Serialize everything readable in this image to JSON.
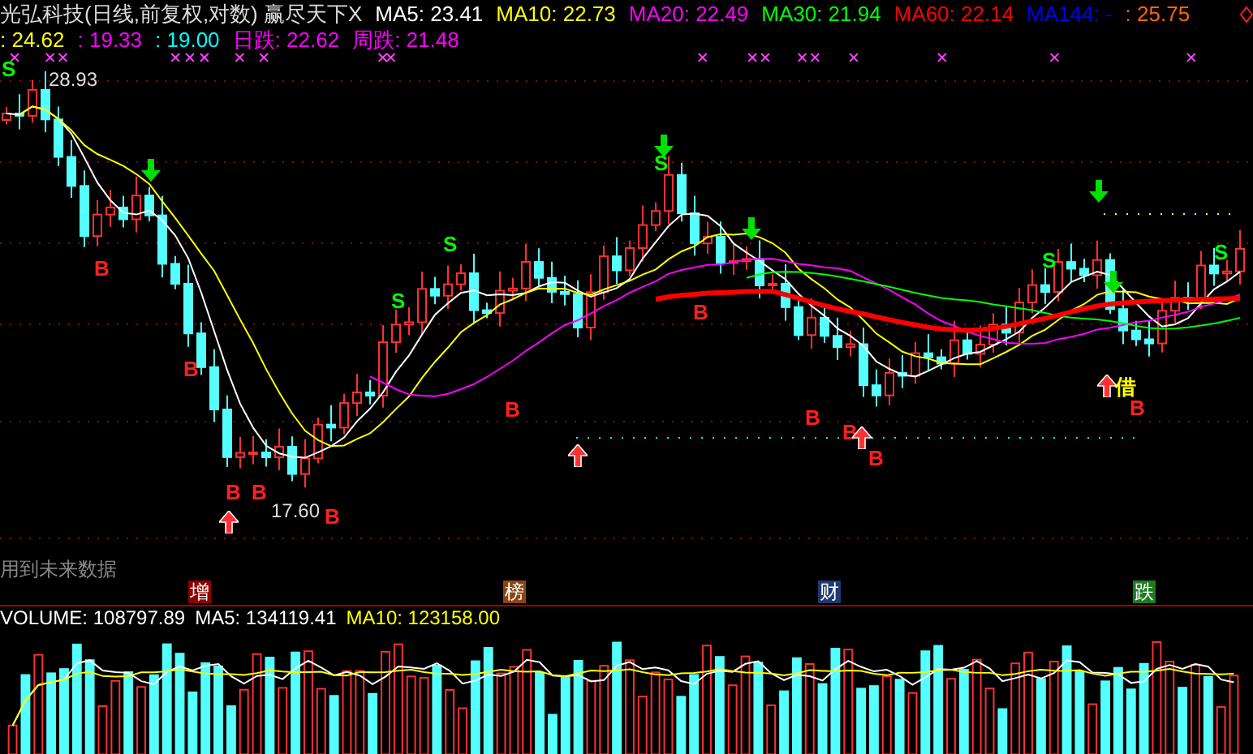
{
  "header": {
    "title": "光弘科技(日线,前复权,对数) 赢尽天下X",
    "indicators": [
      {
        "text": "MA5: 23.41",
        "color": "#ffffff"
      },
      {
        "text": "MA10: 22.73",
        "color": "#ffff00"
      },
      {
        "text": "MA20: 22.49",
        "color": "#ff00ff"
      },
      {
        "text": "MA30: 21.94",
        "color": "#00ff00"
      },
      {
        "text": "MA60: 22.14",
        "color": "#ff0000"
      },
      {
        "text": "MA144: -",
        "color": "#0000ff"
      },
      {
        "text": ": 25.75",
        "color": "#ff6600"
      }
    ],
    "indicators_line_2": [
      {
        "text": ": 24.62",
        "color": "#ffff00"
      },
      {
        "text": ": 19.33",
        "color": "#ff00ff"
      },
      {
        "text": ": 19.00",
        "color": "#00ffff"
      },
      {
        "text": "日跌: 22.62",
        "color": "#ff00ff"
      },
      {
        "text": "周跌: 21.48",
        "color": "#ff00ff"
      }
    ]
  },
  "chart": {
    "price_labels": [
      "28.93",
      "17.60"
    ],
    "markers": [
      {
        "kind": "sell",
        "text": "S"
      },
      {
        "kind": "buy",
        "text": "B"
      },
      {
        "kind": "buy",
        "text": "B"
      },
      {
        "kind": "buy",
        "text": "B"
      },
      {
        "kind": "buy",
        "text": "B"
      },
      {
        "kind": "buy",
        "text": "B"
      },
      {
        "kind": "sell",
        "text": "S"
      },
      {
        "kind": "sell",
        "text": "S"
      },
      {
        "kind": "buy",
        "text": "B"
      },
      {
        "kind": "sell",
        "text": "S"
      },
      {
        "kind": "buy",
        "text": "B"
      },
      {
        "kind": "buy",
        "text": "B"
      },
      {
        "kind": "buy",
        "text": "B"
      },
      {
        "kind": "buy",
        "text": "B"
      },
      {
        "kind": "sell",
        "text": "S"
      },
      {
        "kind": "note",
        "text": "借"
      },
      {
        "kind": "buy",
        "text": "B"
      },
      {
        "kind": "sell",
        "text": "S"
      }
    ]
  },
  "notice": "用到未来数据",
  "tags": [
    {
      "text": "增",
      "color": "#8b0000"
    },
    {
      "text": "榜",
      "color": "#8b4513"
    },
    {
      "text": "财",
      "color": "#1e3a6e"
    },
    {
      "text": "跌",
      "color": "#1f7a1f"
    }
  ],
  "volume": {
    "readings": [
      {
        "text": "VOLUME: 108797.89",
        "color": "#ffffff"
      },
      {
        "text": "MA5: 134119.41",
        "color": "#ffffff"
      },
      {
        "text": "MA10: 123158.00",
        "color": "#ffff00"
      }
    ]
  }
}
